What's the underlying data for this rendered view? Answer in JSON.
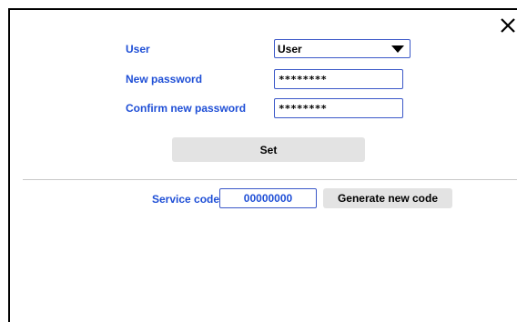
{
  "dialog": {
    "close_icon": "close-icon"
  },
  "form": {
    "user_label": "User",
    "user_selected": "User",
    "new_password_label": "New password",
    "new_password_value": "********",
    "confirm_password_label": "Confirm new password",
    "confirm_password_value": "********",
    "set_label": "Set"
  },
  "service": {
    "label": "Service code",
    "code": "00000000",
    "generate_label": "Generate new code"
  },
  "colors": {
    "label_blue": "#1f4fd6",
    "field_border": "#3b58c8",
    "button_bg": "#e3e3e3"
  }
}
